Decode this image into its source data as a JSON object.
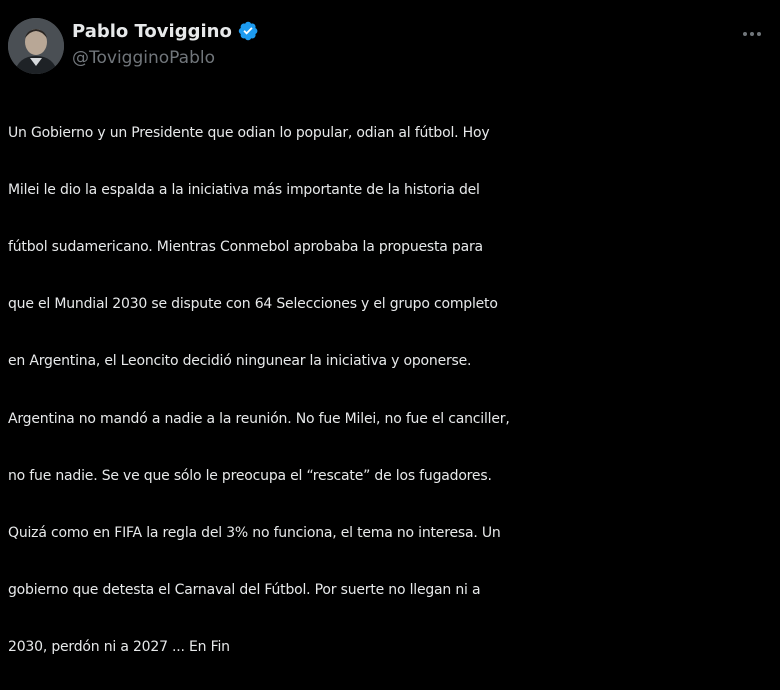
{
  "author": {
    "display_name": "Pablo Toviggino",
    "handle": "@TovigginoPablo",
    "verified": true,
    "verified_color": "#1d9bf0"
  },
  "icons": {
    "avatar": "avatar-photo",
    "verified": "verified-badge-icon",
    "more": "more-options-icon"
  },
  "tweet": {
    "lines": [
      "Un Gobierno y un Presidente que odian lo popular, odian al fútbol. Hoy",
      "Milei le dio la espalda a la iniciativa más importante de la historia del",
      "fútbol sudamericano. Mientras Conmebol aprobaba la propuesta para",
      "que el Mundial 2030 se dispute con 64 Selecciones y el grupo completo",
      "en Argentina, el Leoncito decidió ningunear la iniciativa y oponerse.",
      "Argentina no mandó a nadie a la reunión. No fue Milei, no fue el canciller,",
      "no fue nadie. Se ve que sólo le preocupa el “rescate” de los fugadores.",
      "Quizá como en FIFA la regla del 3% no funciona, el tema no interesa. Un",
      "gobierno que detesta el Carnaval del Fútbol. Por suerte no llegan ni a",
      "2030, perdón ni a 2027 ... En Fin"
    ]
  },
  "colors": {
    "background": "#000000",
    "text": "#e7e9ea",
    "secondary_text": "#71767b"
  }
}
